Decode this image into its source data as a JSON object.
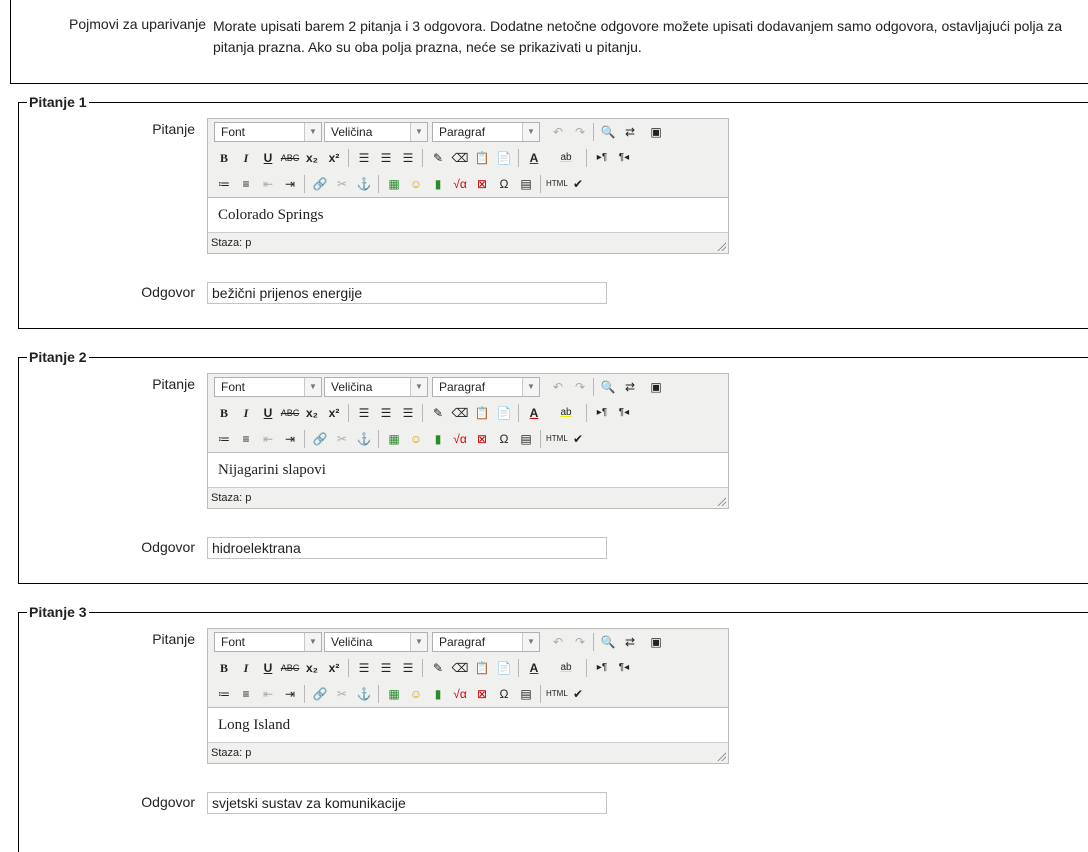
{
  "intro": {
    "label": "Pojmovi za uparivanje",
    "text": "Morate upisati barem 2 pitanja i 3 odgovora. Dodatne netočne odgovore možete upisati dodavanjem samo odgovora, ostavljajući polja za pitanja prazna. Ako su oba polja prazna, neće se prikazivati u pitanju."
  },
  "labels": {
    "question": "Pitanje",
    "answer": "Odgovor"
  },
  "toolbar": {
    "font": "Font",
    "size": "Veličina",
    "format": "Paragraf",
    "status": "Staza: p"
  },
  "items": [
    {
      "legend": "Pitanje 1",
      "question": "Colorado Springs",
      "answer": "bežični prijenos energije"
    },
    {
      "legend": "Pitanje 2",
      "question": "Nijagarini slapovi",
      "answer": "hidroelektrana"
    },
    {
      "legend": "Pitanje 3",
      "question": "Long Island",
      "answer": "svjetski sustav za komunikacije"
    }
  ]
}
